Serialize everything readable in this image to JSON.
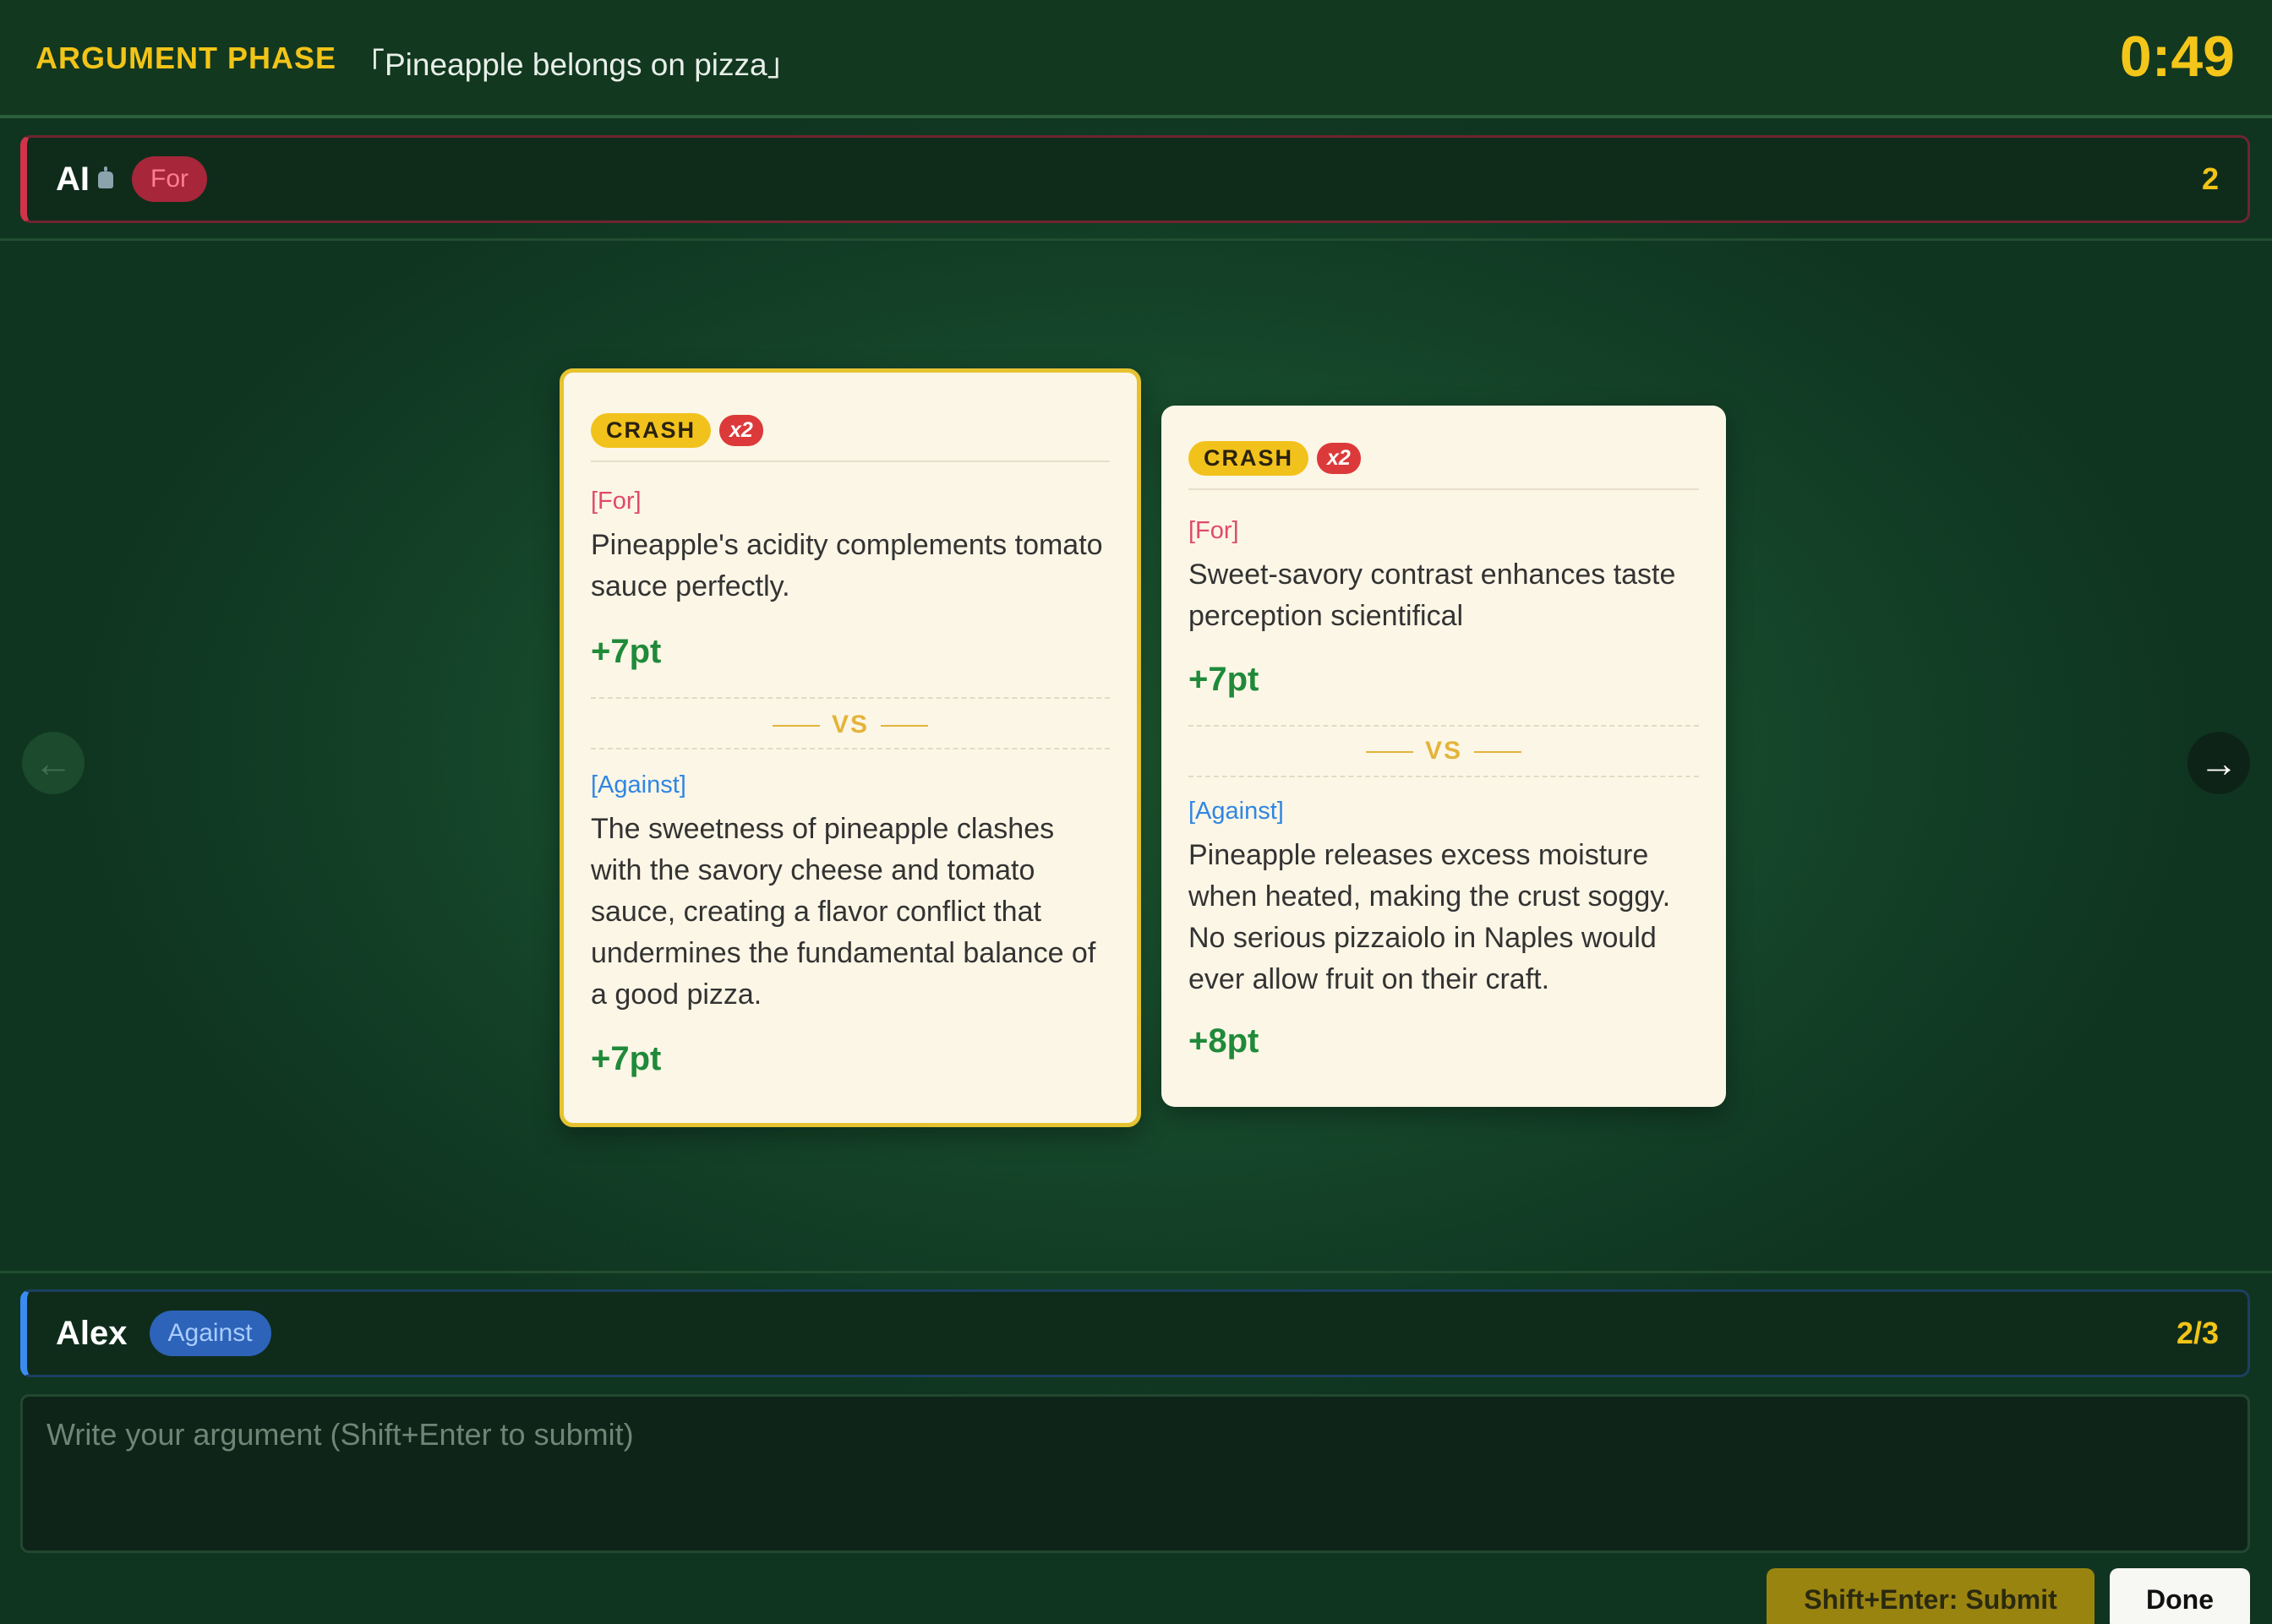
{
  "header": {
    "phase": "ARGUMENT PHASE",
    "topic": "「Pineapple belongs on pizza」",
    "timer": "0:49"
  },
  "opponent": {
    "name": "AI",
    "side": "For",
    "score": "2"
  },
  "player": {
    "name": "Alex",
    "side": "Against",
    "progress": "2/3"
  },
  "cards": [
    {
      "tag": "CRASH",
      "multiplier": "x2",
      "for_label": "[For]",
      "for_text": "Pineapple's acidity complements tomato sauce perfectly.",
      "for_points": "+7pt",
      "vs": "VS",
      "against_label": "[Against]",
      "against_text": "The sweetness of pineapple clashes with the savory cheese and tomato sauce, creating a flavor conflict that undermines the fundamental balance of a good pizza.",
      "against_points": "+7pt"
    },
    {
      "tag": "CRASH",
      "multiplier": "x2",
      "for_label": "[For]",
      "for_text": "Sweet-savory contrast enhances taste perception scientifical",
      "for_points": "+7pt",
      "vs": "VS",
      "against_label": "[Against]",
      "against_text": "Pineapple releases excess moisture when heated, making the crust soggy. No serious pizzaiolo in Naples would ever allow fruit on their craft.",
      "against_points": "+8pt"
    }
  ],
  "nav": {
    "prev_icon": "←",
    "next_icon": "→"
  },
  "input": {
    "placeholder": "Write your argument (Shift+Enter to submit)",
    "value": ""
  },
  "buttons": {
    "submit": "Shift+Enter: Submit",
    "done": "Done"
  },
  "colors": {
    "accent_yellow": "#f2c418",
    "for_red": "#d1334a",
    "against_blue": "#3a8cf0",
    "points_green": "#1f8a3a"
  }
}
